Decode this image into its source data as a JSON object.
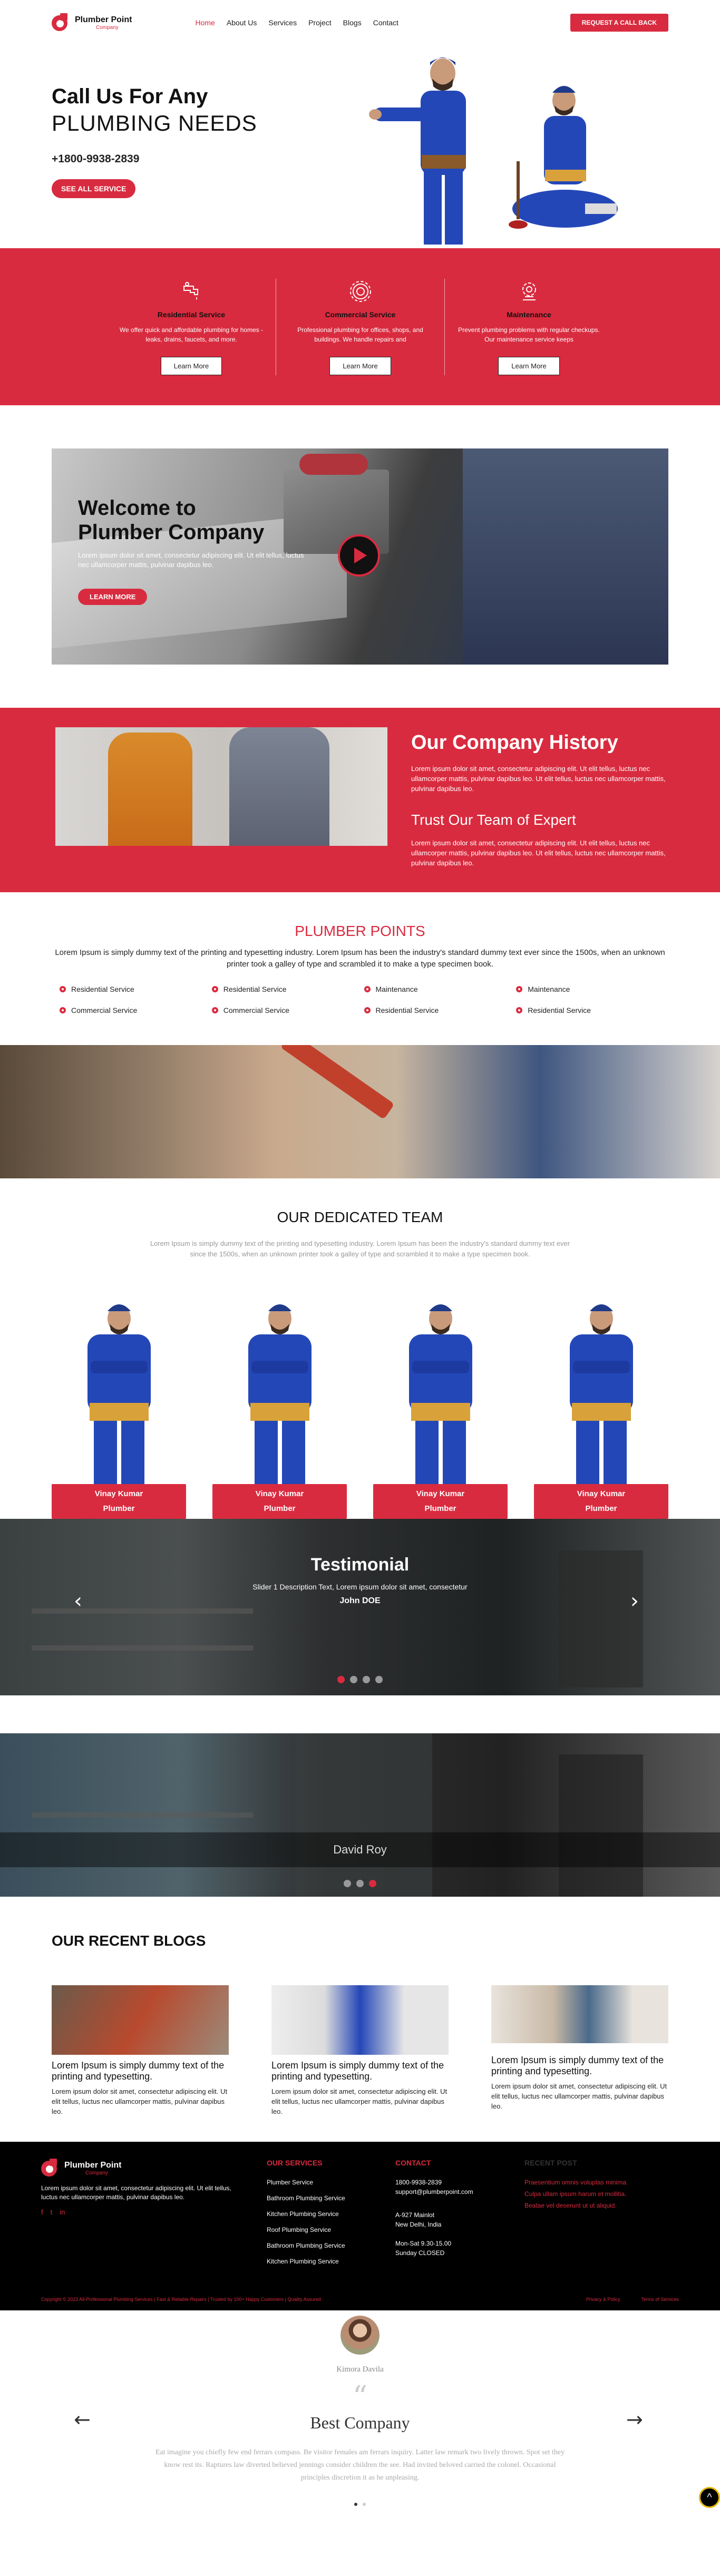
{
  "header": {
    "logo_title": "Plumber Point",
    "logo_sub": "Company",
    "nav": [
      "Home",
      "About Us",
      "Services",
      "Project",
      "Blogs",
      "Contact"
    ],
    "cta": "REQUEST A CALL BACK"
  },
  "hero": {
    "line1": "Call Us For Any",
    "line2": "PLUMBING NEEDS",
    "phone": "+1800-9938-2839",
    "button": "SEE ALL SERVICE"
  },
  "services": [
    {
      "icon": "faucet-icon",
      "title": "Residential Service",
      "text": "We offer quick and affordable plumbing for homes - leaks, drains, faucets, and more.",
      "button": "Learn More"
    },
    {
      "icon": "gear-icon",
      "title": "Commercial Service",
      "text": "Professional plumbing for offices, shops, and buildings. We handle repairs and",
      "button": "Learn More"
    },
    {
      "icon": "maintenance-gear-icon",
      "title": "Maintenance",
      "text": "Prevent plumbing problems with regular checkups. Our maintenance service keeps",
      "button": "Learn More"
    }
  ],
  "welcome": {
    "title1": "Welcome to",
    "title2": "Plumber Company",
    "text": "Lorem ipsum dolor sit amet, consectetur adipiscing elit. Ut elit tellus, luctus nec ullamcorper mattis, pulvinar dapibus leo.",
    "button": "LEARN MORE"
  },
  "history": {
    "title": "Our Company History",
    "text1": "Lorem ipsum dolor sit amet, consectetur adipiscing elit. Ut elit tellus, luctus nec ullamcorper mattis, pulvinar dapibus leo. Ut elit tellus, luctus nec ullamcorper mattis, pulvinar dapibus leo.",
    "subtitle": "Trust Our Team of Expert",
    "text2": "Lorem ipsum dolor sit amet, consectetur adipiscing elit. Ut elit tellus, luctus nec ullamcorper mattis, pulvinar dapibus leo. Ut elit tellus, luctus nec ullamcorper mattis, pulvinar dapibus leo."
  },
  "points": {
    "title": "PLUMBER POINTS",
    "lead": "Lorem Ipsum is simply dummy text of the printing and typesetting industry. Lorem Ipsum has been the industry's standard dummy text ever since the 1500s, when an unknown printer took a galley of type and scrambled it to make a type specimen book.",
    "items": [
      "Residential Service",
      "Residential Service",
      "Maintenance",
      "Maintenance",
      "Commercial Service",
      "Commercial Service",
      "Residential Service",
      "Residential Service"
    ]
  },
  "team": {
    "title": "OUR DEDICATED TEAM",
    "lead": "Lorem Ipsum is simply dummy text of the printing and typesetting industry. Lorem Ipsum has been the industry's standard dummy text ever since the 1500s, when an unknown printer took a galley of type and scrambled it to make a type specimen book.",
    "members": [
      {
        "name": "Vinay Kumar",
        "role": "Plumber"
      },
      {
        "name": "Vinay Kumar",
        "role": "Plumber"
      },
      {
        "name": "Vinay Kumar",
        "role": "Plumber"
      },
      {
        "name": "Vinay Kumar",
        "role": "Plumber"
      }
    ]
  },
  "testimonial": {
    "title": "Testimonial",
    "text": "Slider 1 Description Text, Lorem ipsum dolor sit amet, consectetur",
    "author": "John DOE",
    "prev": "‹",
    "next": "›"
  },
  "slider2": {
    "caption": "David Roy"
  },
  "blogs": {
    "title": "OUR RECENT BLOGS",
    "posts": [
      {
        "title": "Lorem Ipsum is simply dummy text of the printing and typesetting.",
        "text": "Lorem ipsum dolor sit amet, consectetur adipiscing elit. Ut elit tellus, luctus nec ullamcorper mattis, pulvinar dapibus leo."
      },
      {
        "title": "Lorem Ipsum is simply dummy text of the printing and typesetting.",
        "text": "Lorem ipsum dolor sit amet, consectetur adipiscing elit. Ut elit tellus, luctus nec ullamcorper mattis, pulvinar dapibus leo."
      },
      {
        "title": "Lorem Ipsum is simply dummy text of the printing and typesetting.",
        "text": "Lorem ipsum dolor sit amet, consectetur adipiscing elit. Ut elit tellus, luctus nec ullamcorper mattis, pulvinar dapibus leo."
      }
    ]
  },
  "footer": {
    "about": "Lorem ipsum dolor sit amet, consectetur adipiscing elit. Ut elit tellus, luctus nec ullamcorper mattis, pulvinar dapibus leo.",
    "social": [
      "f",
      "t",
      "in"
    ],
    "services_title": "OUR SERVICES",
    "services": [
      "Plumber Service",
      "Bathroom Plumbing Service",
      "Kitchen Plumbing Service",
      "Roof Plumbing Service",
      "Bathroom Plumbing Service",
      "Kitchen Plumbing Service"
    ],
    "contact_title": "CONTACT",
    "contact": [
      "1800-9938-2839",
      "support@plumberpoint.com",
      "A-927 Mainlot",
      "New Delhi, India",
      "Mon-Sat 9.30-15.00",
      "Sunday CLOSED"
    ],
    "recent_title": "RECENT POST",
    "recent": [
      "Praesentium omnis voluptas minima.",
      "Culpa ullam ipsum harum et mollitia.",
      "Beatae vel deserunt ut ut aliquid."
    ],
    "copyright": "Copyright © 2023 All-Professional Plumbing Services | Fast & Reliable Repairs | Trusted by 100+ Happy Customers | Quality Assured",
    "policy": "Privacy & Policy",
    "terms": "Terms of Services"
  },
  "bestco": {
    "name": "Kimora Davila",
    "title": "Best Company",
    "text": "Eat imagine you chiefly few end ferrars compass. Be visitor females am ferrars inquiry. Latter law remark two lively thrown. Spot set they know rest its. Raptures law diverted believed jennings consider children the see. Had invited beloved carried the colonel. Occasional principles discretion it as he unpleasing.",
    "prev": "←",
    "next": "→",
    "scrolltop": "^"
  },
  "colors": {
    "accent": "#d92b3f",
    "dark": "#111111",
    "footer": "#000000"
  }
}
